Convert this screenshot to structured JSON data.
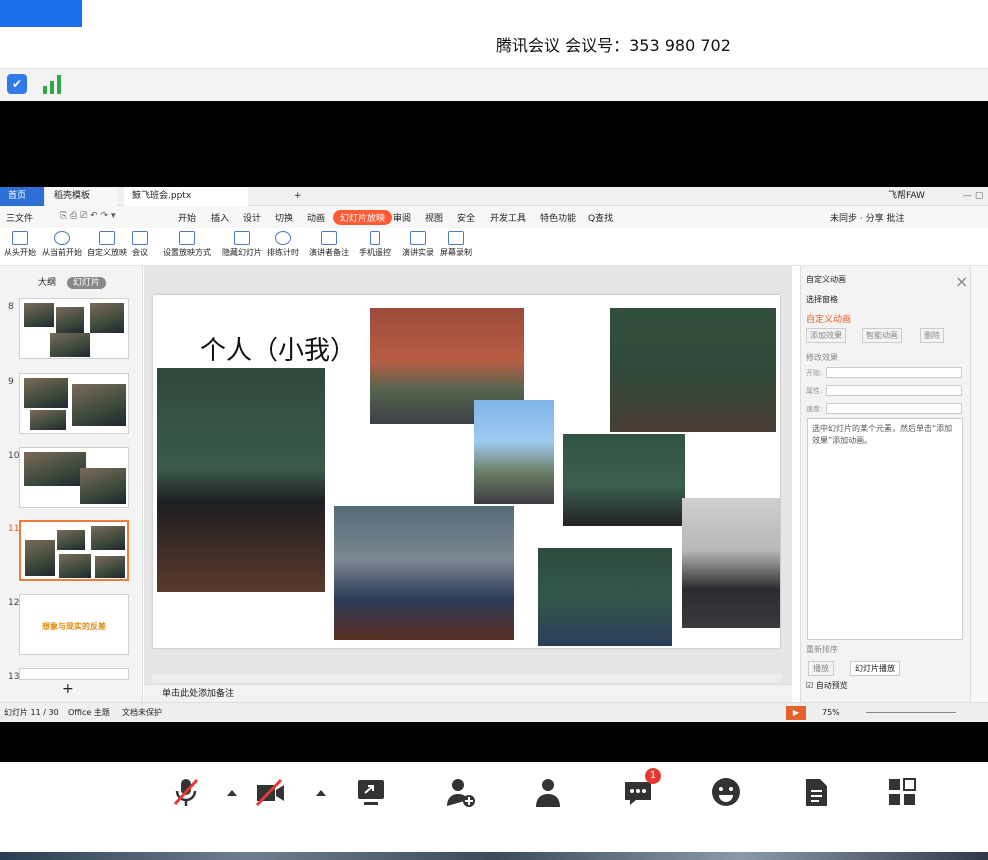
{
  "meeting": {
    "label": "腾讯会议 会议号：353 980 702"
  },
  "tabs": {
    "home": "首页",
    "templates": "稻壳模板",
    "doc": "鲸飞班会.pptx",
    "plus": "+",
    "user": "飞帮FAW"
  },
  "menu": {
    "file": "三文件",
    "items": [
      "开始",
      "插入",
      "设计",
      "切换",
      "动画"
    ],
    "active": "幻灯片放映",
    "items2": [
      "审阅",
      "视图",
      "安全",
      "开发工具",
      "特色功能"
    ],
    "search": "Q查找",
    "right": "未同步 · 分享 批注"
  },
  "ribbon": [
    "从头开始",
    "从当前开始",
    "自定义放映",
    "会议",
    "设置放映方式",
    "隐藏幻灯片",
    "排练计时",
    "演讲者备注",
    "手机遥控",
    "演讲实录",
    "屏幕录制"
  ],
  "left_panel": {
    "tab_outline": "大纲",
    "tab_slides": "幻灯片",
    "slide_numbers": [
      "8",
      "9",
      "10",
      "11",
      "12",
      "13"
    ],
    "slide12_text": "想象与现实的反差",
    "add": "+"
  },
  "slide": {
    "title": "个人（小我）"
  },
  "notes": {
    "placeholder": "单击此处添加备注"
  },
  "right_panel": {
    "header": "自定义动画",
    "select_pane": "选择窗格",
    "custom_anim": "自定义动画",
    "add_effect": "添加效果",
    "smart_anim": "智能动画",
    "delete": "删除",
    "modify": "修改效果",
    "start": "开始:",
    "property": "属性:",
    "speed": "速度:",
    "hint": "选中幻灯片的某个元素，然后单击“添加效果”添加动画。",
    "reorder": "重新排序",
    "play": "播放",
    "slideshow": "幻灯片播放",
    "autopreview": "自动预览"
  },
  "status": {
    "slide": "幻灯片 11 / 30",
    "theme": "Office 主题",
    "protect": "文档未保护",
    "zoom": "75%"
  },
  "meeting_toolbar": {
    "chat_badge": "1"
  }
}
